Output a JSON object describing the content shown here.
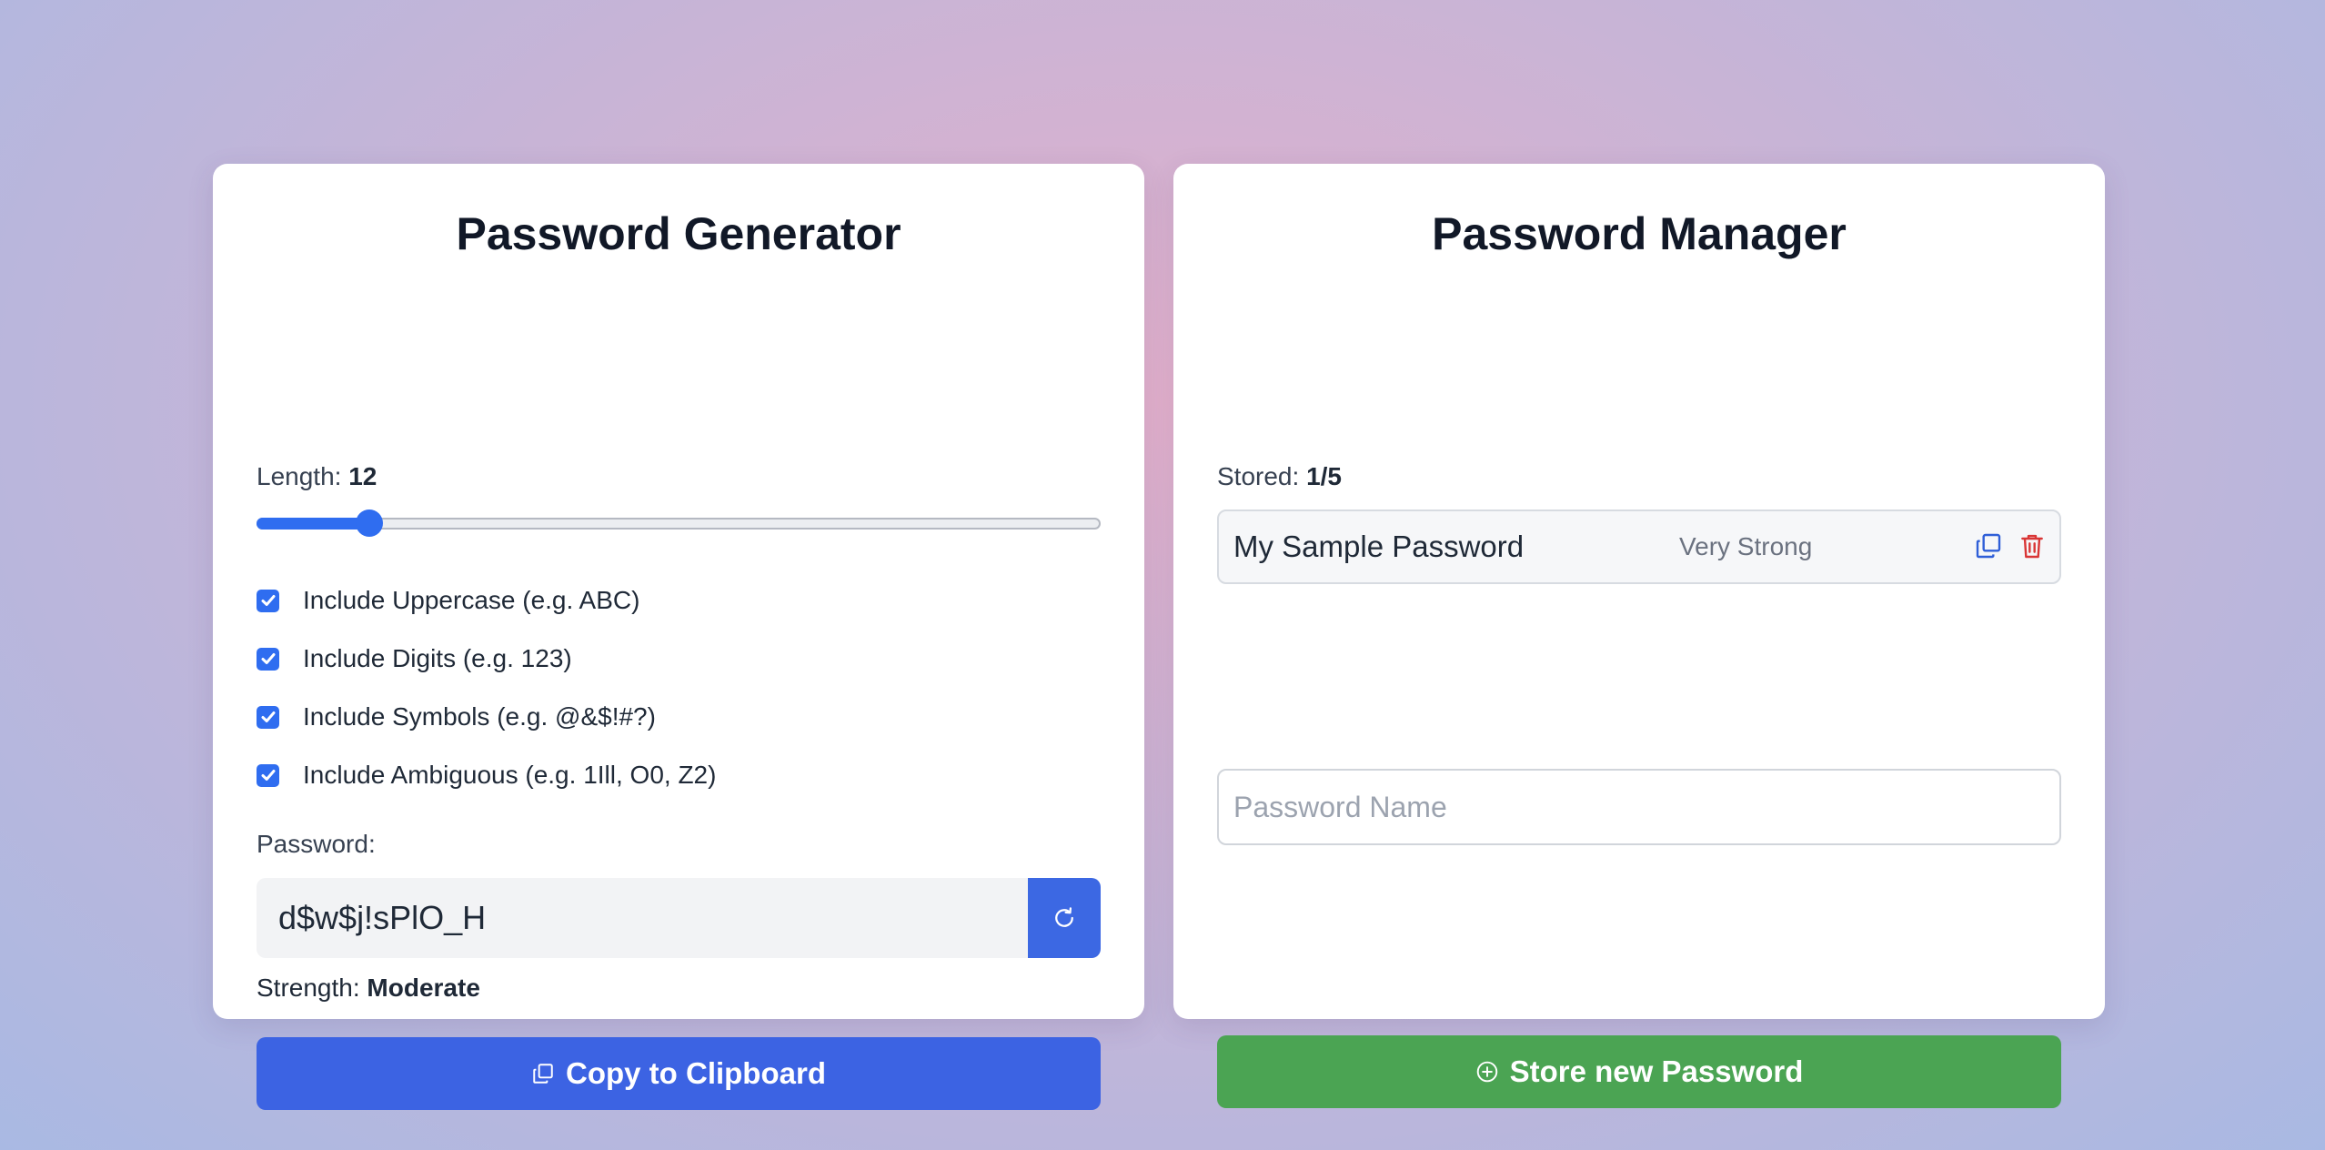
{
  "generator": {
    "title": "Password Generator",
    "length_label": "Length:",
    "length_value": 12,
    "length_min": 4,
    "length_max": 64,
    "options": [
      {
        "label": "Include Uppercase (e.g. ABC)",
        "checked": true
      },
      {
        "label": "Include Digits (e.g. 123)",
        "checked": true
      },
      {
        "label": "Include Symbols (e.g. @&$!#?)",
        "checked": true
      },
      {
        "label": "Include Ambiguous (e.g. 1Ill, O0, Z2)",
        "checked": true
      }
    ],
    "password_label": "Password:",
    "password_value": "d$w$j!sPlO_H",
    "strength_label": "Strength:",
    "strength_value": "Moderate",
    "copy_button_label": "Copy to Clipboard",
    "refresh_icon": "refresh-icon",
    "copy_icon": "copy-icon"
  },
  "manager": {
    "title": "Password Manager",
    "stored_label": "Stored:",
    "stored_value": "1/5",
    "entries": [
      {
        "name": "My Sample Password",
        "strength": "Very Strong"
      }
    ],
    "name_placeholder": "Password Name",
    "store_button_label": "Store new Password",
    "store_icon": "plus-circle-icon"
  },
  "colors": {
    "accent": "#3c63e3",
    "success": "#4ba453",
    "danger": "#d93636"
  }
}
